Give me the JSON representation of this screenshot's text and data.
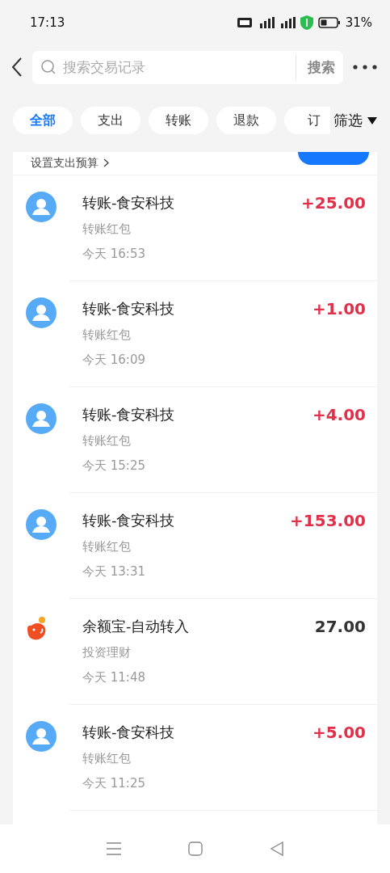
{
  "status_bar": {
    "time": "17:13",
    "battery": "31%"
  },
  "search": {
    "placeholder": "搜索交易记录",
    "button": "搜索"
  },
  "tabs": [
    {
      "label": "全部",
      "selected": true
    },
    {
      "label": "支出",
      "selected": false
    },
    {
      "label": "转账",
      "selected": false
    },
    {
      "label": "退款",
      "selected": false
    },
    {
      "label": "订",
      "selected": false
    }
  ],
  "filter": "筛选",
  "budget_banner": {
    "label": "设置支出预算"
  },
  "transactions": [
    {
      "kind": "person",
      "title": "转账-食安科技",
      "category": "转账红包",
      "time": "今天 16:53",
      "amount": "+25.00",
      "income": true
    },
    {
      "kind": "person",
      "title": "转账-食安科技",
      "category": "转账红包",
      "time": "今天 16:09",
      "amount": "+1.00",
      "income": true
    },
    {
      "kind": "person",
      "title": "转账-食安科技",
      "category": "转账红包",
      "time": "今天 15:25",
      "amount": "+4.00",
      "income": true
    },
    {
      "kind": "person",
      "title": "转账-食安科技",
      "category": "转账红包",
      "time": "今天 13:31",
      "amount": "+153.00",
      "income": true
    },
    {
      "kind": "fund",
      "title": "余额宝-自动转入",
      "category": "投资理财",
      "time": "今天 11:48",
      "amount": "27.00",
      "income": false
    },
    {
      "kind": "person",
      "title": "转账-食安科技",
      "category": "转账红包",
      "time": "今天 11:25",
      "amount": "+5.00",
      "income": true
    }
  ]
}
